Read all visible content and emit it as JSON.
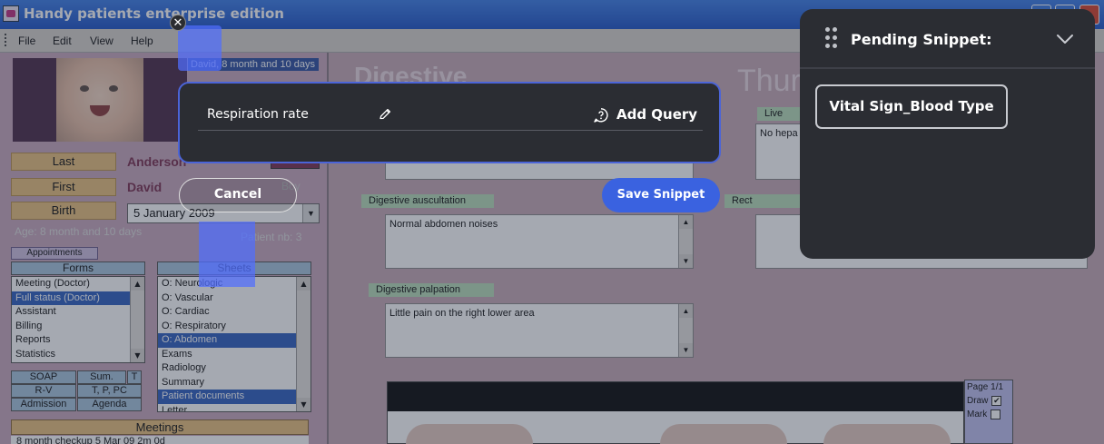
{
  "app": {
    "title": "Handy patients enterprise edition",
    "menu": [
      "File",
      "Edit",
      "View",
      "Help"
    ],
    "patient": {
      "last_label": "Last",
      "last_value": "Anderson",
      "first_label": "First",
      "first_value": "David",
      "birth_label": "Birth",
      "birth_value": "5   January   2009",
      "age": "Age: 8 month and 10 days",
      "patient_nb": "Patient nb: 3",
      "boy": "Boy",
      "banner": "David, 8 month and 10 days"
    },
    "appointments_button": "Appointments",
    "forms": {
      "header": "Forms",
      "items": [
        "Meeting (Doctor)",
        "Full status (Doctor)",
        "Assistant",
        "Billing",
        "Reports",
        "Statistics"
      ],
      "selected_index": 1
    },
    "sheets": {
      "header": "Sheets",
      "items": [
        "O: Neurologic",
        "O: Vascular",
        "O: Cardiac",
        "O: Respiratory",
        "O: Abdomen",
        "Exams",
        "Radiology",
        "Summary",
        "Patient documents",
        "Letter"
      ],
      "selected_indices": [
        4,
        8
      ]
    },
    "nav": {
      "soap": "SOAP",
      "sum": "Sum.",
      "t": "T",
      "rv": "R-V",
      "tppc": "T, P, PC",
      "admission": "Admission",
      "agenda": "Agenda"
    },
    "meetings": {
      "header": "Meetings",
      "row": "8 month checkup     5 Mar 09     2m 0d"
    },
    "main": {
      "section_title": "Digestive",
      "date_title": "Thurs",
      "liver_label": "Live",
      "liver_text": "No hepa",
      "rectal_label": "Rect",
      "auscultation_label": "Digestive auscultation",
      "auscultation_text": "Normal abdomen noises",
      "palpation_label": "Digestive palpation",
      "palpation_text": "Little pain on the right lower area",
      "page_label": "Page 1/1",
      "draw_label": "Draw",
      "mark_label": "Mark"
    }
  },
  "snippet_editor": {
    "field_name": "Respiration rate",
    "add_query": "Add Query",
    "cancel": "Cancel",
    "save": "Save Snippet"
  },
  "pending_panel": {
    "title": "Pending Snippet:",
    "chip": "Vital Sign_Blood Type"
  },
  "colors": {
    "accent": "#3a62e0",
    "panel_bg": "#2b2d33",
    "selection": "#506eff"
  }
}
